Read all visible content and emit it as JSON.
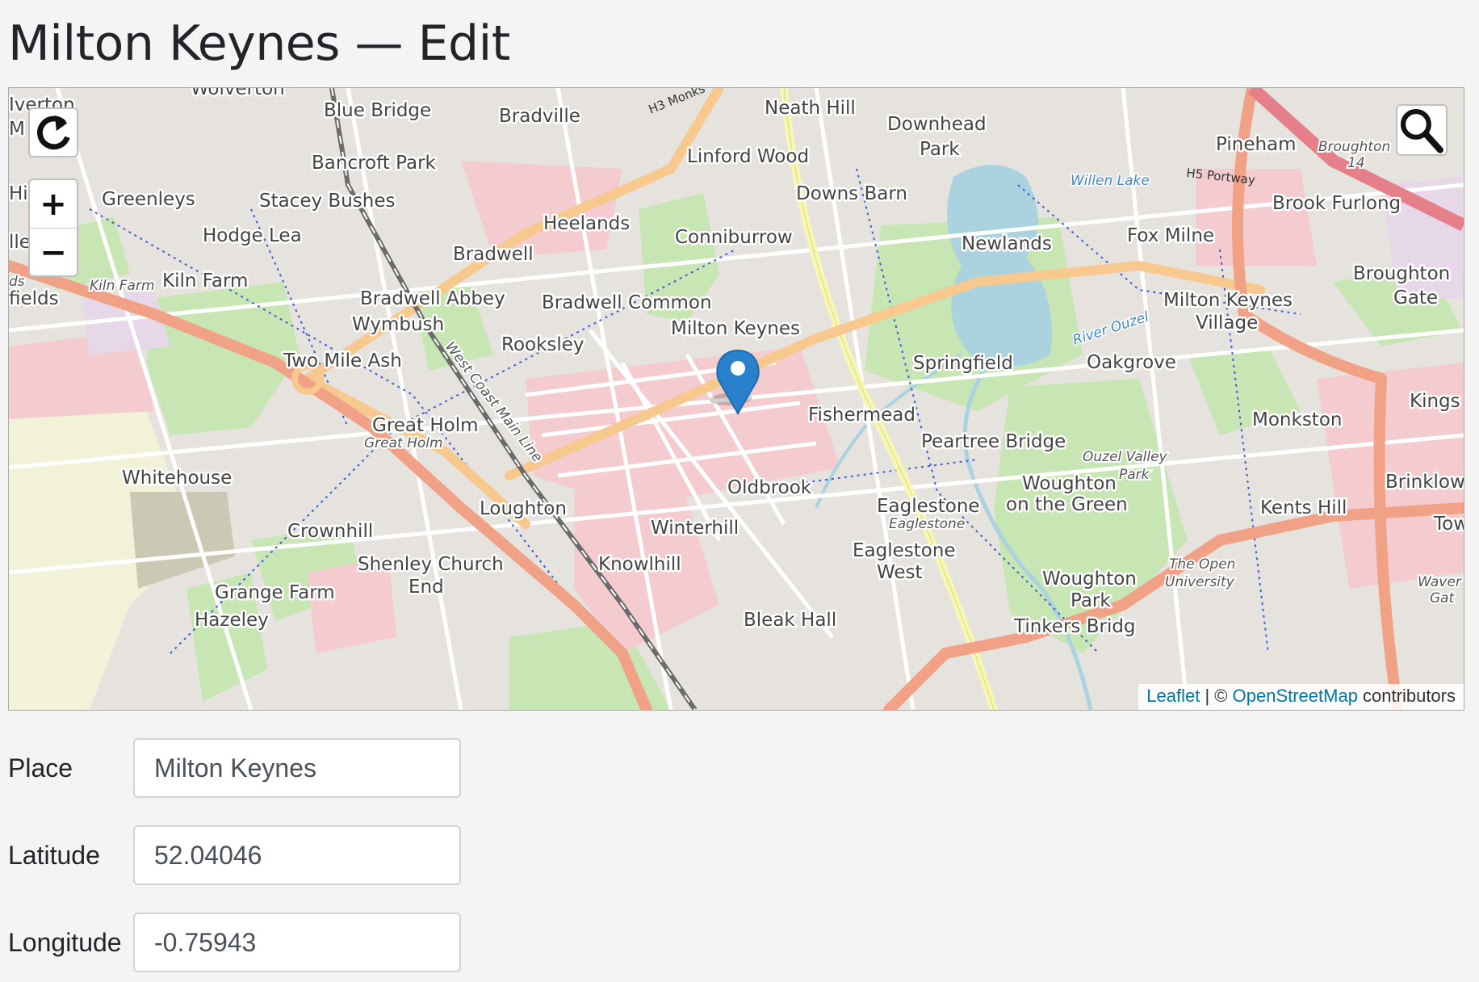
{
  "page": {
    "title": "Milton Keynes — Edit"
  },
  "map": {
    "controls": {
      "reset_icon": "refresh-icon",
      "zoom_in_label": "+",
      "zoom_out_label": "−",
      "search_icon": "search-icon"
    },
    "marker_icon": "map-pin-icon",
    "attribution": {
      "leaflet": "Leaflet",
      "separator": " | © ",
      "osm": "OpenStreetMap",
      "suffix": " contributors"
    },
    "labels": {
      "blue_bridge": "Blue Bridge",
      "bradville": "Bradville",
      "neath_hill": "Neath Hill",
      "downhead": "Downhead",
      "park": "Park",
      "pineham": "Pineham",
      "broughton": "Broughton",
      "linford_wood": "Linford Wood",
      "bancroft_park": "Bancroft Park",
      "greenleys": "Greenleys",
      "stacey_bushes": "Stacey Bushes",
      "downs_barn": "Downs Barn",
      "willen_lake": "Willen Lake",
      "brook_furlong": "Brook Furlong",
      "heelands": "Heelands",
      "hodge_lea": "Hodge Lea",
      "conniburrow": "Conniburrow",
      "newlands": "Newlands",
      "fox_milne": "Fox Milne",
      "bradwell": "Bradwell",
      "kiln_farm_small": "Kiln Farm",
      "kiln_farm": "Kiln Farm",
      "broughton_gate_1": "Broughton",
      "broughton_gate_2": "Gate",
      "bradwell_abbey": "Bradwell Abbey",
      "bradwell_common": "Bradwell Common",
      "mk_village_1": "Milton Keynes",
      "mk_village_2": "Village",
      "wymbush": "Wymbush",
      "milton_keynes": "Milton Keynes",
      "river_ouzel": "River Ouzel",
      "rooksley": "Rooksley",
      "two_mile_ash": "Two Mile Ash",
      "springfield": "Springfield",
      "oakgrove": "Oakgrove",
      "kingston": "Kings",
      "fishermead": "Fishermead",
      "great_holm": "Great Holm",
      "great_holm_small": "Great Holm",
      "monkston": "Monkston",
      "peartree_bridge": "Peartree Bridge",
      "ouzel_valley_1": "Ouzel Valley",
      "ouzel_valley_2": "Park",
      "whitehouse": "Whitehouse",
      "woughton_1": "Woughton",
      "woughton_2": "on the Green",
      "brinklow": "Brinklow",
      "oldbrook": "Oldbrook",
      "eaglestone": "Eaglestone",
      "eaglestone_small": "Eaglestone",
      "kents_hill": "Kents Hill",
      "loughton": "Loughton",
      "crownhill": "Crownhill",
      "winterhill": "Winterhill",
      "tower": "Tow",
      "shenley_1": "Shenley Church",
      "shenley_2": "End",
      "knowlhill": "Knowlhill",
      "eaglestone_west_1": "Eaglestone",
      "eaglestone_west_2": "West",
      "open_uni_1": "The Open",
      "open_uni_2": "University",
      "woughton_park_1": "Woughton",
      "woughton_park_2": "Park",
      "grange_farm": "Grange Farm",
      "wavendon_1": "Waver",
      "wavendon_2": "Gat",
      "hazeley": "Hazeley",
      "bleak_hall": "Bleak Hall",
      "tinkers_bridge": "Tinkers Bridg",
      "west_coast": "West Coast Main Line",
      "h3_monks": "H3 Monks",
      "h5_portway": "H5 Portway",
      "fields": "fields",
      "ds": "ds",
      "lle_ide": "lle  ide",
      "hil": "Hil",
      "iverton": "Iverton",
      "m": "M",
      "wolverton": "Wolverton",
      "b14": "14"
    }
  },
  "form": {
    "place": {
      "label": "Place",
      "value": "Milton Keynes"
    },
    "latitude": {
      "label": "Latitude",
      "value": "52.04046"
    },
    "longitude": {
      "label": "Longitude",
      "value": "-0.75943"
    }
  }
}
